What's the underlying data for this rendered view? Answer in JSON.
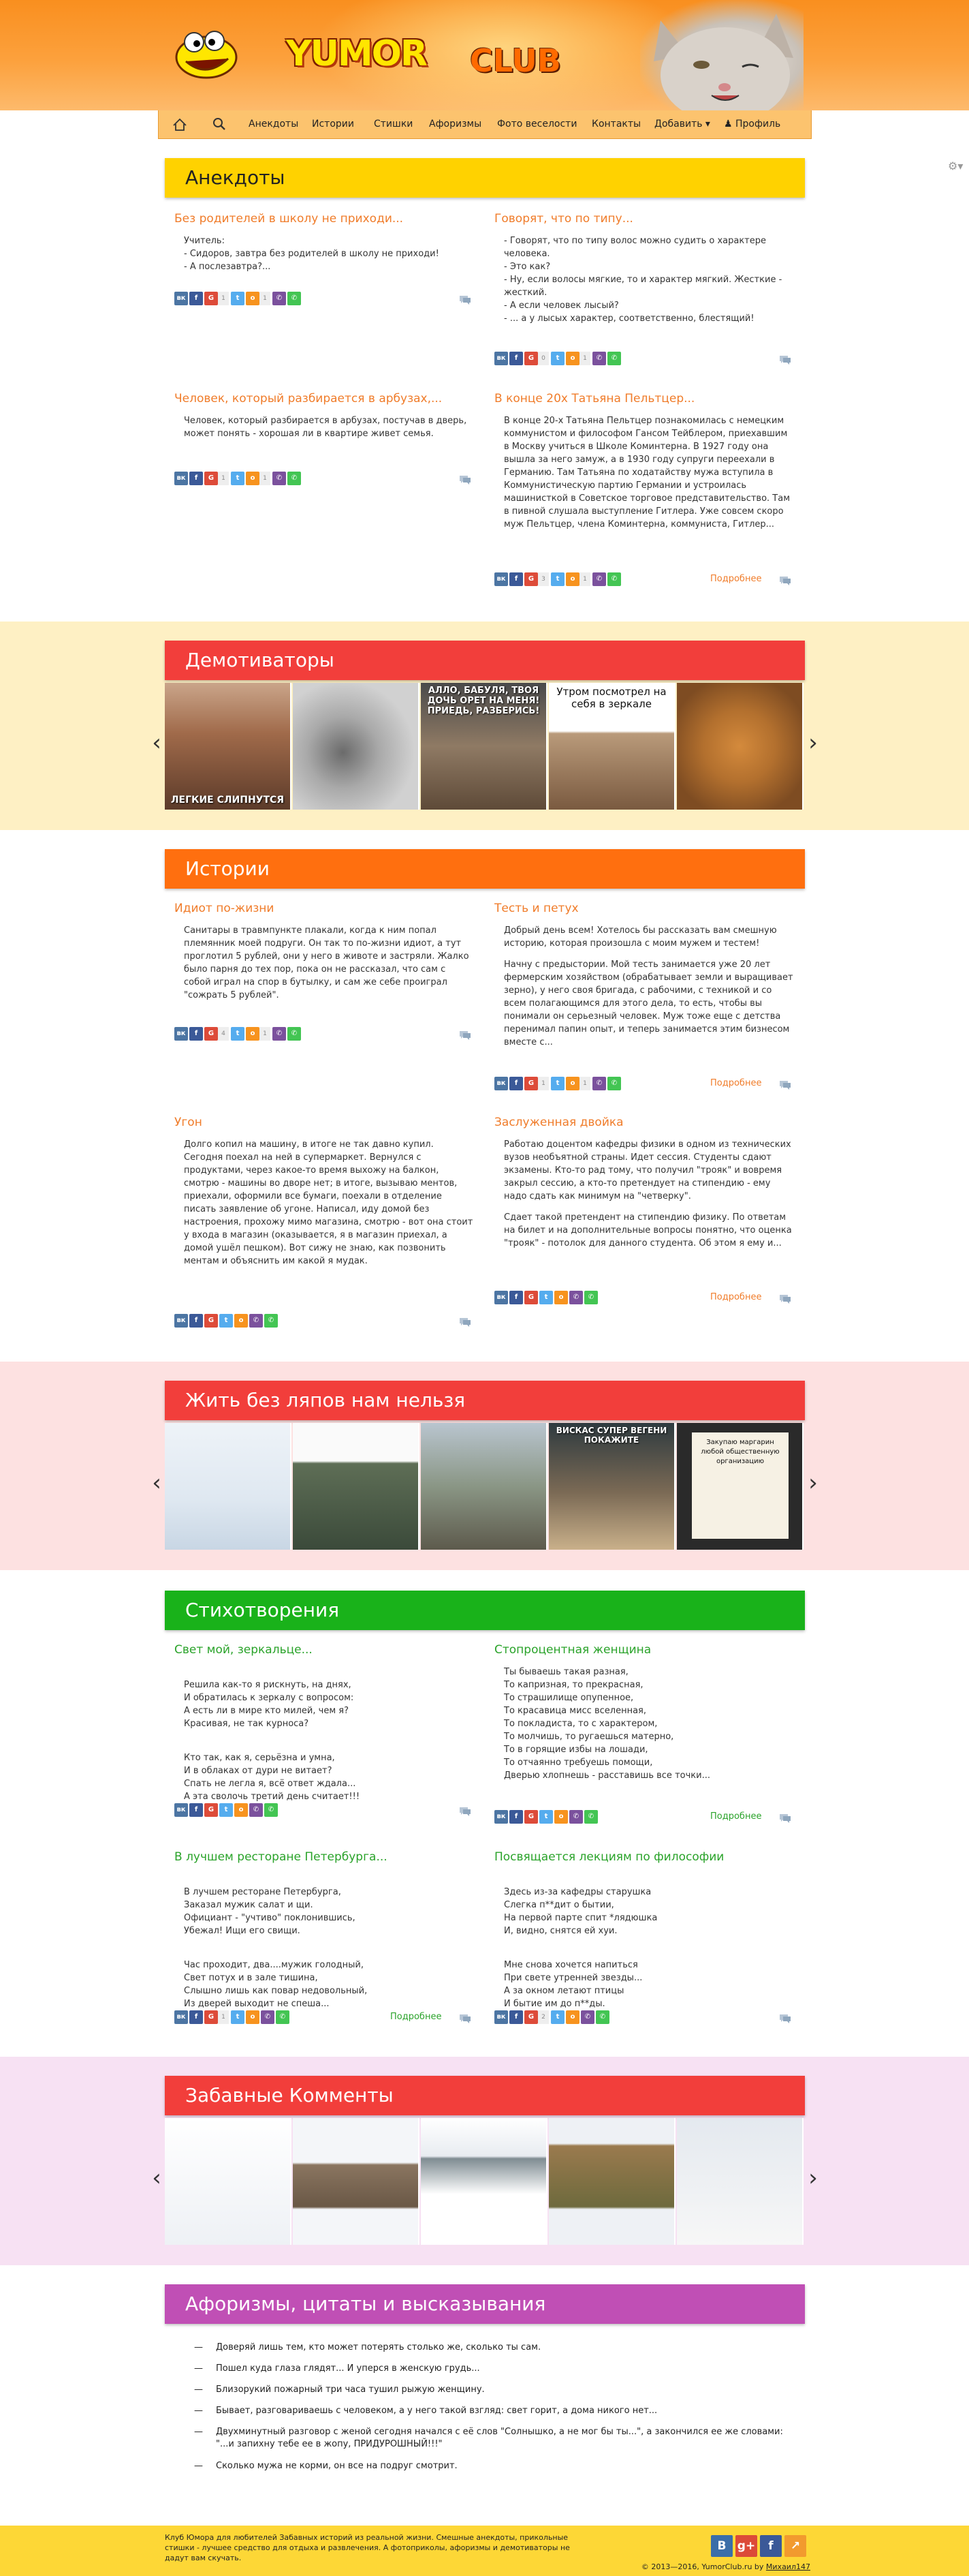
{
  "header": {
    "logo_main": "YUMOR",
    "logo_club": "CLUB"
  },
  "nav": {
    "home_icon": "home-icon",
    "search_icon": "search-icon",
    "items": [
      "Анекдоты",
      "Истории",
      "Стишки",
      "Афоризмы",
      "Фото веселости",
      "Контакты",
      "Добавить ▾",
      "Профиль"
    ]
  },
  "share_icons": [
    "vk",
    "facebook",
    "google-plus",
    "twitter",
    "odnoklassniki",
    "viber",
    "whatsapp"
  ],
  "sections": {
    "anekdoty": {
      "title": "Анекдоты",
      "color": "#ffd200",
      "posts": [
        {
          "title": "Без родителей в школу не приходи...",
          "text": [
            "Учитель:",
            "- Сидоров, завтра без родителей в школу не приходи!",
            "- А послезавтра?..."
          ],
          "counts": [
            "1",
            "",
            "",
            "1"
          ],
          "more": ""
        },
        {
          "title": "Говорят, что по типу...",
          "text": [
            "- Говорят, что по типу волос можно судить о характере человека.",
            "- Это как?",
            "- Ну, если волосы мягкие, то и характер мягкий. Жесткие - жесткий.",
            "- А если человек лысый?",
            "- ... а у лысых характер, соответственно, блестящий!"
          ],
          "counts": [
            "0",
            "",
            "",
            "1"
          ],
          "more": ""
        },
        {
          "title": "Человек, который разбирается в арбузах,...",
          "text": [
            "Человек, который разбирается в арбузах, постучав в дверь, может понять - хорошая ли в квартире живет семья."
          ],
          "counts": [
            "1",
            "",
            "",
            "1"
          ],
          "more": ""
        },
        {
          "title": "В конце 20х Татьяна Пельтцер...",
          "text": [
            "В конце 20-х Татьяна Пельтцер познакомилась с немецким коммунистом и философом Гансом Тейблером, приехавшим в Москву учиться в Школе Коминтерна. В 1927 году она вышла за него замуж, а в 1930 году супруги переехали в Германию. Там Татьяна по ходатайству мужа вступила в Коммунистическую партию Германии и устроилась машинисткой в Советское торговое представительство. Там в пивной слушала выступление Гитлера. Уже совсем скоро муж Пельтцер, члена Коминтерна, коммуниста, Гитлер..."
          ],
          "counts": [
            "3",
            "",
            "",
            "1"
          ],
          "more": "Подробнее"
        }
      ]
    },
    "demotivatory": {
      "title": "Демотиваторы",
      "color": "#f23e3b",
      "captions": [
        "ЛЕГКИЕ СЛИПНУТСЯ",
        "",
        "АЛЛО, БАБУЛЯ, ТВОЯ ДОЧЬ ОРЕТ НА МЕНЯ! ПРИЕДЬ, РАЗБЕРИСЬ!",
        "Утром посмотрел на себя в зеркале",
        ""
      ]
    },
    "istorii": {
      "title": "Истории",
      "color": "#ff6f0f",
      "posts": [
        {
          "title": "Идиот по-жизни",
          "text": [
            "Санитары в травмпункте плакали, когда к ним попал племянник моей подруги. Он так то по-жизни идиот, а тут проглотил 5 рублей, они у него в животе и застряли. Жалко было парня до тех пор, пока он не рассказал, что сам с собой играл на спор в бутылку, и сам же себе проиграл \"сожрать 5 рублей\"."
          ],
          "counts": [
            "4",
            "",
            "",
            "1"
          ],
          "more": ""
        },
        {
          "title": "Тесть и петух",
          "text": [
            "Добрый день всем! Хотелось бы рассказать вам смешную историю, которая произошла с моим мужем и тестем!",
            "Начну с предыстории. Мой тесть занимается уже 20 лет фермерским хозяйством (обрабатывает земли и выращивает зерно), у него своя бригада, с рабочими, с техникой и со всем полагающимся для этого дела, то есть, чтобы вы понимали он серьезный человек. Муж тоже еще с детства перенимал папин опыт, и теперь занимается этим бизнесом вместе с..."
          ],
          "counts": [
            "1",
            "",
            "",
            "1"
          ],
          "more": "Подробнее"
        },
        {
          "title": "Угон",
          "text": [
            "Долго копил на машину, в итоге не так давно купил. Сегодня поехал на ней в супермаркет. Вернулся с продуктами, через какое-то время выхожу на балкон, смотрю - машины во дворе нет; в итоге, вызываю ментов, приехали, оформили все бумаги, поехали в отделение писать заявление об угоне. Написал, иду домой без настроения, прохожу мимо магазина, смотрю - вот она стоит у входа в магазин (оказывается, я в магазин приехал, а домой ушёл пешком). Вот сижу не знаю, как позвонить ментам и объяснить им какой я мудак."
          ],
          "counts": [
            "",
            "",
            "",
            ""
          ],
          "more": ""
        },
        {
          "title": "Заслуженная двойка",
          "text": [
            "Работаю доцентом кафедры физики в одном из технических вузов необъятной страны. Идет сессия. Студенты сдают экзамены. Кто-то рад тому, что получил \"трояк\" и вовремя закрыл сессию, а кто-то претендует на стипендию - ему надо сдать как минимум на \"четверку\".",
            "Сдает такой претендент на стипендию физику. По ответам на билет и на дополнительные вопросы понятно, что оценка \"трояк\" - потолок для данного студента. Об этом я ему и..."
          ],
          "counts": [
            "",
            "",
            "",
            ""
          ],
          "more": "Подробнее"
        }
      ]
    },
    "lyapy": {
      "title": "Жить без ляпов нам нельзя",
      "color": "#f23e3b",
      "captions": [
        "",
        "",
        "",
        "ВИСКАС СУПЕР ВЕГЕНИ ПОКАЖИТЕ",
        "Закупаю маргарин любой общественную организацию"
      ]
    },
    "stihi": {
      "title": "Стихотворения",
      "color": "#19b21a",
      "posts": [
        {
          "title": "Свет мой, зеркальце...",
          "text": [
            "Решила как-то я рискнуть, на днях,\nИ обратилась к зеркалу с вопросом:\nА есть ли в мире кто милей, чем я?\nКрасивая, не так курноса?",
            "Кто так, как я, серьёзна и умна,\nИ в облаках от дури не витает?\nСпать не легла я, всё ответ ждала...\nА эта сволочь третий день считает!!!"
          ],
          "counts": [
            "",
            "",
            "",
            ""
          ],
          "more": ""
        },
        {
          "title": "Стопроцентная женщина",
          "text": [
            "Ты бываешь такая разная,\nТо капризная, то прекрасная,\nТо страшилище опупенное,\nТо красавица мисс вселенная,\nТо покладиста, то с характером,\nТо молчишь, то ругаешься матерно,\nТо в горящие избы на лошади,\nТо отчаянно требуешь помощи,\nДверью хлопнешь - расставишь все точки..."
          ],
          "counts": [
            "",
            "",
            "",
            ""
          ],
          "more": "Подробнее"
        },
        {
          "title": "В лучшем ресторане Петербурга...",
          "text": [
            "В лучшем ресторане Петербурга,\nЗаказал мужик салат и щи.\nОфициант - \"учтиво\" поклонившись,\nУбежал! Ищи его свищи.",
            "Час проходит, два....мужик голодный,\nСвет потух и в зале тишина,\nСлышно лишь как повар недовольный,\nИз дверей выходит не спеша..."
          ],
          "counts": [
            "1",
            "",
            "",
            ""
          ],
          "more": "Подробнее"
        },
        {
          "title": "Посвящается лекциям по философии",
          "text": [
            "Здесь из-за кафедры старушка\nСлегка п**дит о бытии,\nНа первой парте спит *лядюшка\nИ, видно, снятся ей хуи.",
            "Мне снова хочется напиться\nПри свете утренней звезды...\nА за окном летают птицы\nИ бытие им до п**ды."
          ],
          "counts": [
            "2",
            "",
            "",
            ""
          ],
          "more": ""
        }
      ]
    },
    "kommenty": {
      "title": "Забавные Комменты",
      "color": "#f23e3b"
    },
    "aforizmy": {
      "title": "Афоризмы, цитаты и высказывания",
      "color": "#c04fb5",
      "items": [
        "Доверяй лишь тем, кто может потерять столько же, сколько ты сам.",
        "Пошел куда глаза глядят... И уперся в женскую грудь...",
        "Близорукий пожарный три часа тушил рыжую женщину.",
        "Бывает, разговариваешь с человеком, а у него такой взгляд: свет горит, а дома никого нет...",
        "Двухминутный разговор с женой сегодня начался с её слов \"Солнышко, а не мог бы ты...\", а закончился ее же словами: \"...и запихну тебе ее в жопу, ПРИДУРОШНЫЙ!!!\"",
        "Сколько мужа не корми, он все на подруг смотрит."
      ]
    }
  },
  "footer": {
    "about": "Клуб Юмора для любителей Забавных историй из реальной жизни. Смешные анекдоты, прикольные стишки - лучшее средство для отдыха и развлечения. А фотоприколы, афоризмы и демотиваторы не дадут вам скучать.",
    "copyright": "© 2013—2016, YumorClub.ru by ",
    "author": "Михаил147"
  },
  "colors": {
    "link_orange": "#f07c2a",
    "link_green": "#2aa32a",
    "band_demotivatory": "#fef0c4",
    "band_lyapy": "#fde1e1",
    "band_kommenty": "#f7e1f3"
  }
}
